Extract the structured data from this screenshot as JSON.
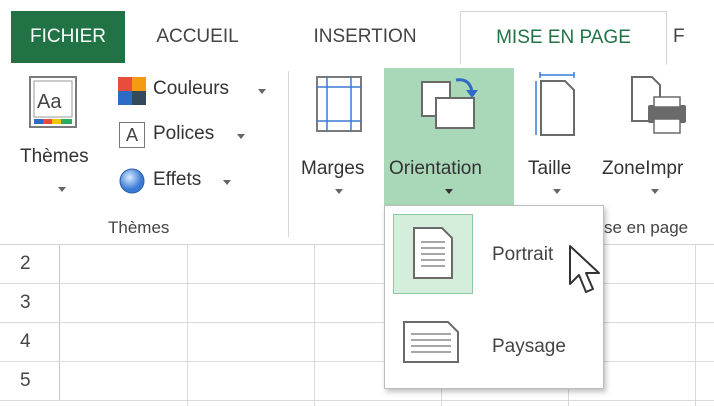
{
  "tabs": {
    "file": "FICHIER",
    "home": "ACCUEIL",
    "insert": "INSERTION",
    "page_layout": "MISE EN PAGE",
    "partial": "F"
  },
  "ribbon": {
    "themes_group": {
      "themes_button": "Thèmes",
      "colors": "Couleurs",
      "fonts": "Polices",
      "effects": "Effets",
      "group_label": "Thèmes"
    },
    "page_setup_group": {
      "margins": "Marges",
      "orientation": "Orientation",
      "size": "Taille",
      "print_area": "ZoneImpr",
      "group_label_partial": "se en page"
    }
  },
  "orientation_menu": {
    "portrait": "Portrait",
    "landscape": "Paysage"
  },
  "row_headers": [
    "2",
    "3",
    "4",
    "5"
  ],
  "colors": {
    "file_tab": "#217346",
    "accent_green": "#217346",
    "selected_green": "#a9d8b8",
    "hover_green": "#d5eedc"
  },
  "icons": {
    "themes": "themes-icon",
    "colors": "colors-icon",
    "fonts": "fonts-icon",
    "effects": "effects-icon",
    "margins": "margins-icon",
    "orientation": "orientation-icon",
    "size": "size-icon",
    "print_area": "print-area-icon",
    "portrait": "portrait-page-icon",
    "landscape": "landscape-page-icon",
    "cursor": "mouse-cursor-icon"
  }
}
